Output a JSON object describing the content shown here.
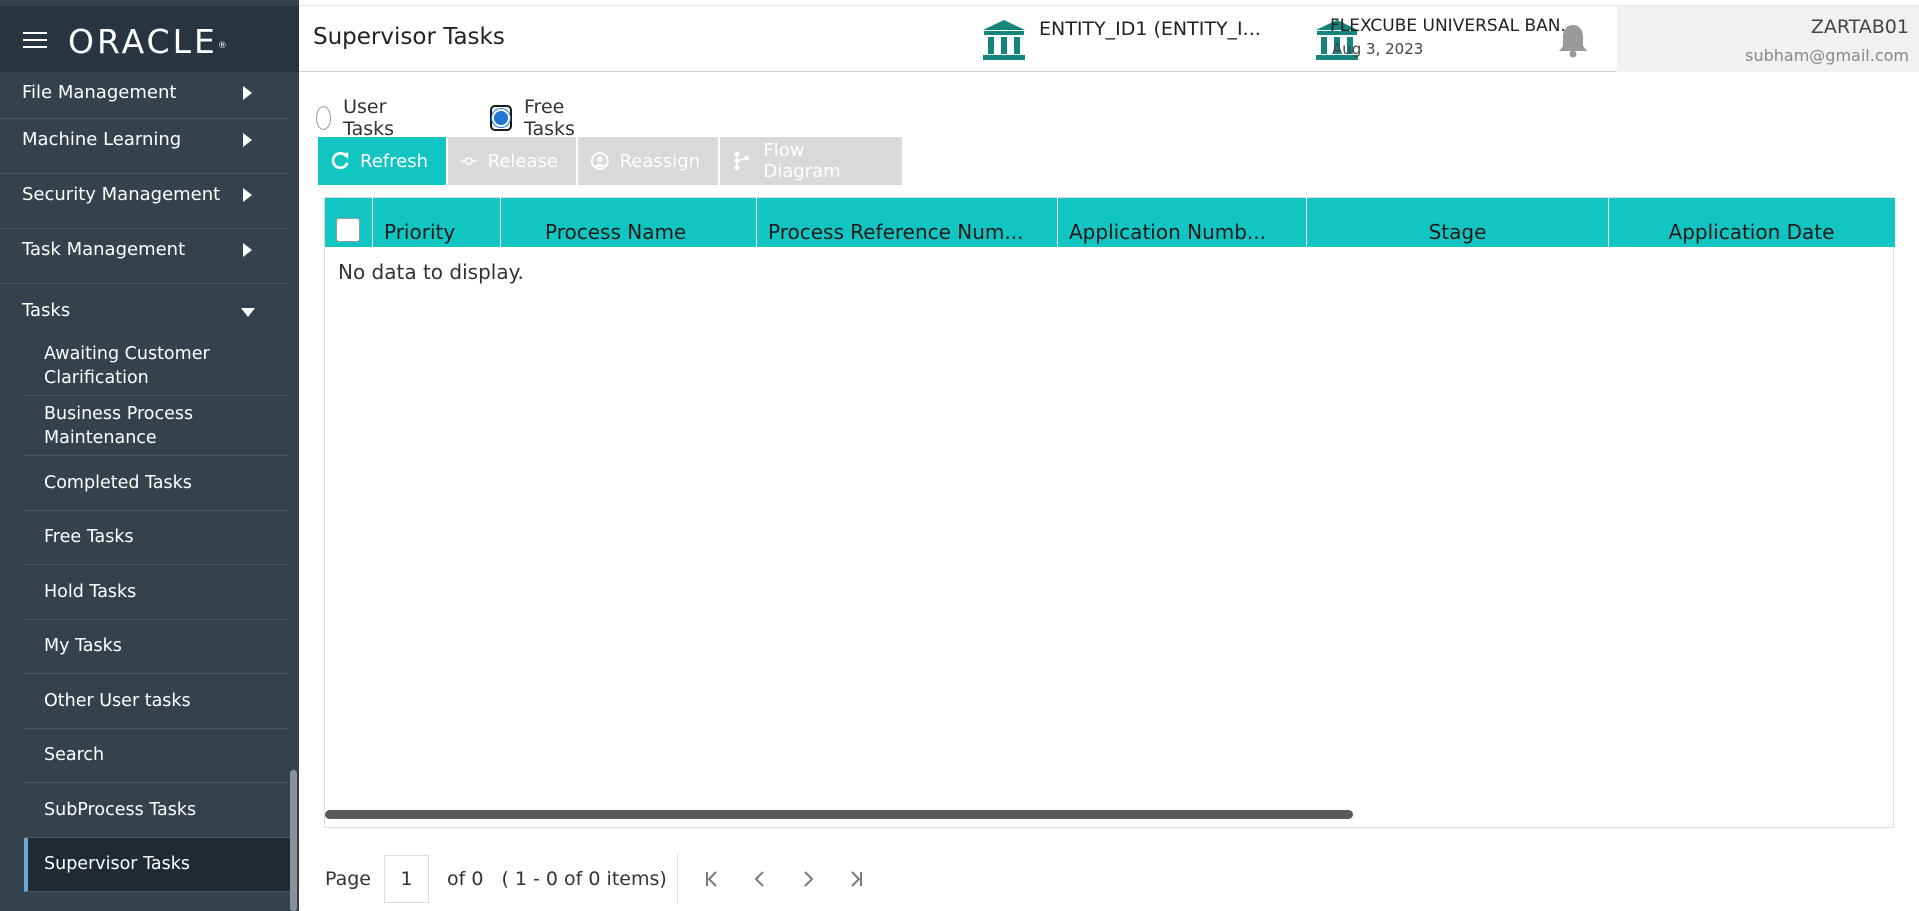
{
  "sidebar": {
    "brand": "ORACLE",
    "brand_mark": "®",
    "menu": [
      {
        "label": "File Management"
      },
      {
        "label": "Machine Learning"
      },
      {
        "label": "Security Management"
      },
      {
        "label": "Task Management"
      },
      {
        "label": "Tasks"
      }
    ],
    "tasks_submenu": [
      {
        "label": "Awaiting Customer Clarification"
      },
      {
        "label": "Business Process Maintenance"
      },
      {
        "label": "Completed Tasks"
      },
      {
        "label": "Free Tasks"
      },
      {
        "label": "Hold Tasks"
      },
      {
        "label": "My Tasks"
      },
      {
        "label": "Other User tasks"
      },
      {
        "label": "Search"
      },
      {
        "label": "SubProcess Tasks"
      },
      {
        "label": "Supervisor Tasks"
      }
    ],
    "active_item": "Supervisor Tasks"
  },
  "header": {
    "page_title": "Supervisor Tasks",
    "entity": "ENTITY_ID1  (ENTITY_I...",
    "bank_name": "FLEXCUBE UNIVERSAL BAN...",
    "date": "Aug 3, 2023",
    "user_name": "ZARTAB01",
    "user_email": "subham@gmail.com"
  },
  "task_filter": {
    "options": [
      {
        "label": "User Tasks",
        "selected": false
      },
      {
        "label": "Free Tasks",
        "selected": true
      }
    ]
  },
  "toolbar": {
    "refresh_label": "Refresh",
    "release_label": "Release",
    "reassign_label": "Reassign",
    "flow_diagram_label": "Flow Diagram"
  },
  "grid": {
    "columns": [
      "Priority",
      "Process Name",
      "Process Reference Num...",
      "Application Numb...",
      "Stage",
      "Application Date"
    ],
    "empty_message": "No data to display."
  },
  "pager": {
    "page_label": "Page",
    "current_page": "1",
    "of_label": "of 0",
    "items_label": "( 1 - 0 of 0 items)"
  },
  "colors": {
    "accent_teal": "#10c5c2",
    "sidebar_bg": "#35414d",
    "sidebar_header_bg": "#283541",
    "icon_teal": "#14857c",
    "radio_blue": "#2076d1",
    "disabled_button": "#d9d9d9"
  },
  "icons": {
    "menu": "hamburger-icon",
    "entity": "bank-icon",
    "notifications": "bell-icon",
    "refresh": "refresh-icon",
    "release": "release-icon",
    "reassign": "reassign-icon",
    "flow": "flow-diagram-icon",
    "pager": [
      "first-page-icon",
      "prev-page-icon",
      "next-page-icon",
      "last-page-icon"
    ]
  }
}
